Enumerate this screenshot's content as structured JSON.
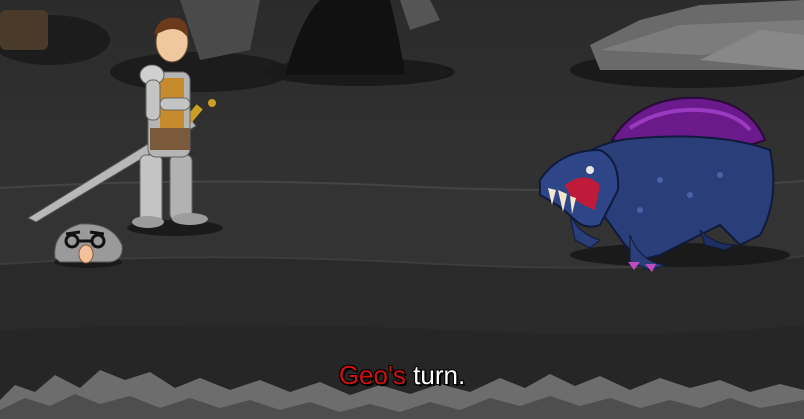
{
  "battle": {
    "turn_name": "Geo's",
    "turn_suffix": " turn."
  },
  "colors": {
    "turn_name": "#cc1111",
    "turn_text": "#ffffff",
    "background": "#2f2f2f",
    "creature_body": "#2a3e7a",
    "creature_shell": "#6a1a8a"
  },
  "icons": {
    "hero": "armored-knight-sprite",
    "companion": "disguise-rock-sprite",
    "enemy": "shelled-beast-sprite"
  }
}
